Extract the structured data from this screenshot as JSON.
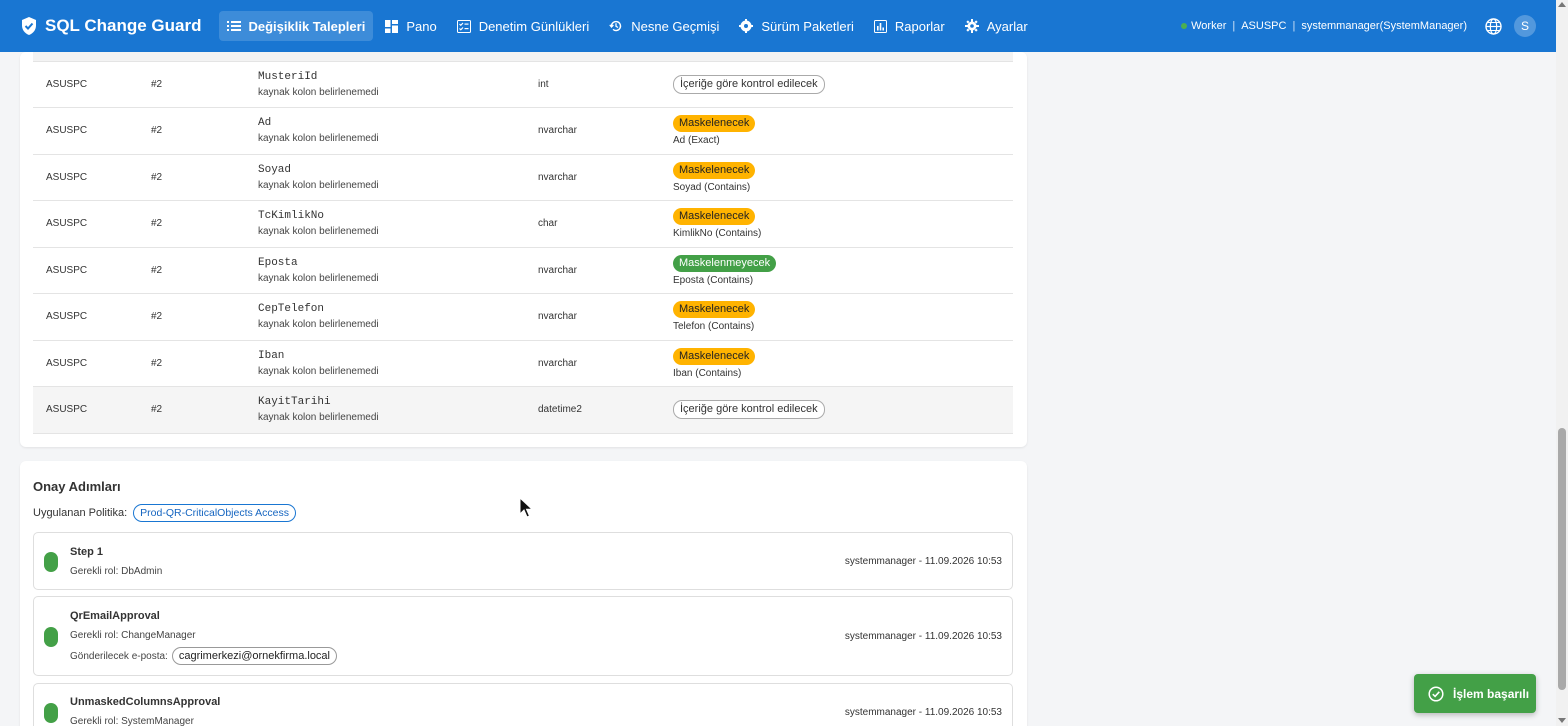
{
  "app": {
    "title": "SQL Change Guard"
  },
  "nav": {
    "items": [
      {
        "label": "Değişiklik Talepleri",
        "icon": "list-icon",
        "active": true
      },
      {
        "label": "Pano",
        "icon": "dashboard-icon"
      },
      {
        "label": "Denetim Günlükleri",
        "icon": "checklist-icon"
      },
      {
        "label": "Nesne Geçmişi",
        "icon": "history-icon"
      },
      {
        "label": "Sürüm Paketleri",
        "icon": "gear-package-icon"
      },
      {
        "label": "Raporlar",
        "icon": "chart-icon"
      },
      {
        "label": "Ayarlar",
        "icon": "settings-icon"
      }
    ]
  },
  "status": {
    "worker": "Worker",
    "host": "ASUSPC",
    "user": "systemmanager(SystemManager)",
    "avatar_letter": "S"
  },
  "columns_table": {
    "rows": [
      {
        "server": "ASUSPC",
        "index": "#2",
        "column": "MusteriId",
        "source": "kaynak kolon belirlenemedi",
        "type": "int",
        "status": "İçeriğe göre kontrol edilecek",
        "status_kind": "outline",
        "rule": ""
      },
      {
        "server": "ASUSPC",
        "index": "#2",
        "column": "Ad",
        "source": "kaynak kolon belirlenemedi",
        "type": "nvarchar",
        "status": "Maskelenecek",
        "status_kind": "warn",
        "rule": "Ad (Exact)"
      },
      {
        "server": "ASUSPC",
        "index": "#2",
        "column": "Soyad",
        "source": "kaynak kolon belirlenemedi",
        "type": "nvarchar",
        "status": "Maskelenecek",
        "status_kind": "warn",
        "rule": "Soyad (Contains)"
      },
      {
        "server": "ASUSPC",
        "index": "#2",
        "column": "TcKimlikNo",
        "source": "kaynak kolon belirlenemedi",
        "type": "char",
        "status": "Maskelenecek",
        "status_kind": "warn",
        "rule": "KimlikNo (Contains)"
      },
      {
        "server": "ASUSPC",
        "index": "#2",
        "column": "Eposta",
        "source": "kaynak kolon belirlenemedi",
        "type": "nvarchar",
        "status": "Maskelenmeyecek",
        "status_kind": "success",
        "rule": "Eposta (Contains)"
      },
      {
        "server": "ASUSPC",
        "index": "#2",
        "column": "CepTelefon",
        "source": "kaynak kolon belirlenemedi",
        "type": "nvarchar",
        "status": "Maskelenecek",
        "status_kind": "warn",
        "rule": "Telefon (Contains)"
      },
      {
        "server": "ASUSPC",
        "index": "#2",
        "column": "Iban",
        "source": "kaynak kolon belirlenemedi",
        "type": "nvarchar",
        "status": "Maskelenecek",
        "status_kind": "warn",
        "rule": "Iban (Contains)"
      },
      {
        "server": "ASUSPC",
        "index": "#2",
        "column": "KayitTarihi",
        "source": "kaynak kolon belirlenemedi",
        "type": "datetime2",
        "status": "İçeriğe göre kontrol edilecek",
        "status_kind": "outline",
        "rule": ""
      }
    ]
  },
  "approval": {
    "title": "Onay Adımları",
    "policy_label": "Uygulanan Politika:",
    "policy_name": "Prod-QR-CriticalObjects Access",
    "steps": [
      {
        "name": "Step 1",
        "role": "Gerekli rol: DbAdmin",
        "meta": "systemmanager - 11.09.2026 10:53"
      },
      {
        "name": "QrEmailApproval",
        "role": "Gerekli rol: ChangeManager",
        "email_label": "Gönderilecek e-posta:",
        "email": "cagrimerkezi@ornekfirma.local",
        "meta": "systemmanager - 11.09.2026 10:53"
      },
      {
        "name": "UnmaskedColumnsApproval",
        "role": "Gerekli rol: SystemManager",
        "meta": "systemmanager - 11.09.2026 10:53"
      }
    ]
  },
  "toast": {
    "message": "İşlem başarılı"
  },
  "colors": {
    "primary": "#1976d2",
    "warn": "#ffb300",
    "success": "#43a047"
  }
}
